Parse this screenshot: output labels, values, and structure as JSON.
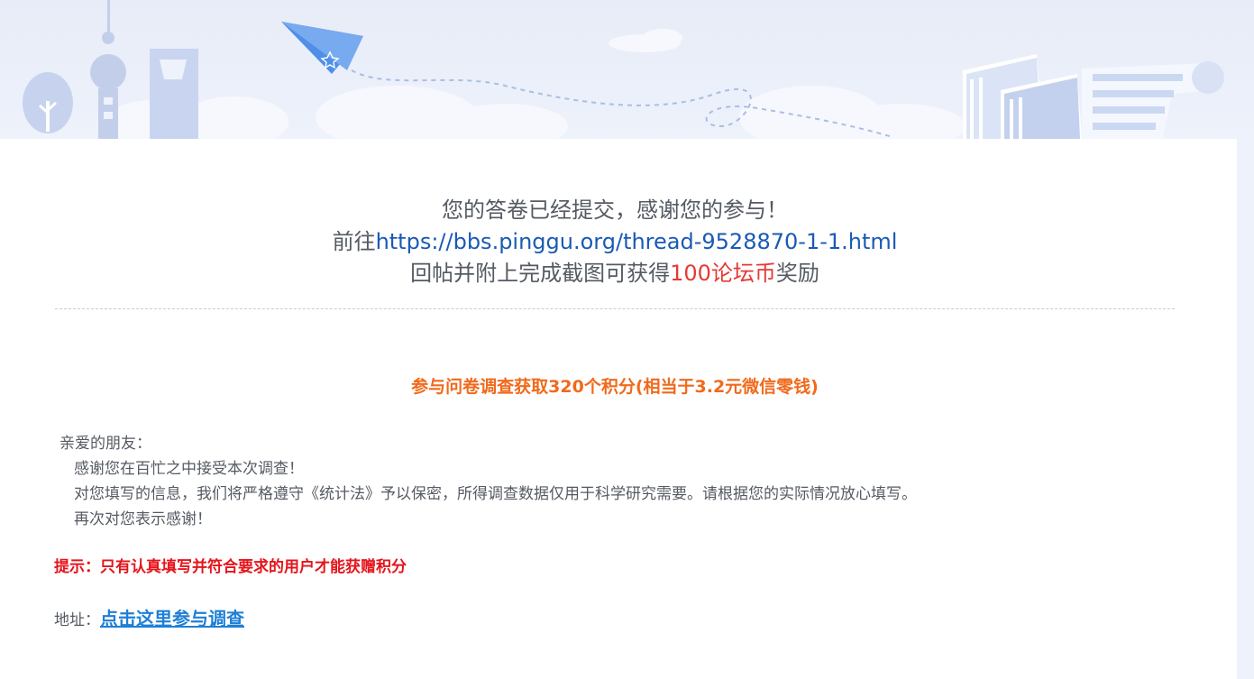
{
  "thanks": {
    "line1": "您的答卷已经提交，感谢您的参与！",
    "line2_prefix": "前往",
    "line2_link": "https://bbs.pinggu.org/thread-9528870-1-1.html",
    "line3_prefix": "回帖并附上完成截图可获得",
    "line3_reward": "100论坛币",
    "line3_suffix": "奖励"
  },
  "survey": {
    "headline": "参与问卷调查获取320个积分(相当于3.2元微信零钱)",
    "greeting": "亲爱的朋友：",
    "para1": "感谢您在百忙之中接受本次调查！",
    "para2": "对您填写的信息，我们将严格遵守《统计法》予以保密，所得调查数据仅用于科学研究需要。请根据您的实际情况放心填写。",
    "para3": "再次对您表示感谢！",
    "tip": "提示：只有认真填写并符合要求的用户才能获赠积分",
    "address_label": "地址：",
    "address_link": "点击这里参与调查"
  },
  "colors": {
    "link_blue": "#1a5ab4",
    "reward_red": "#e53935",
    "headline_orange": "#f06a1c",
    "tip_red": "#e5141b",
    "address_link": "#1e7fd6"
  },
  "icons": [
    "paper-plane-icon",
    "tree-icon",
    "tv-tower-icon",
    "skyscraper-icon",
    "books-icon",
    "scroll-icon",
    "cloud-icon"
  ]
}
